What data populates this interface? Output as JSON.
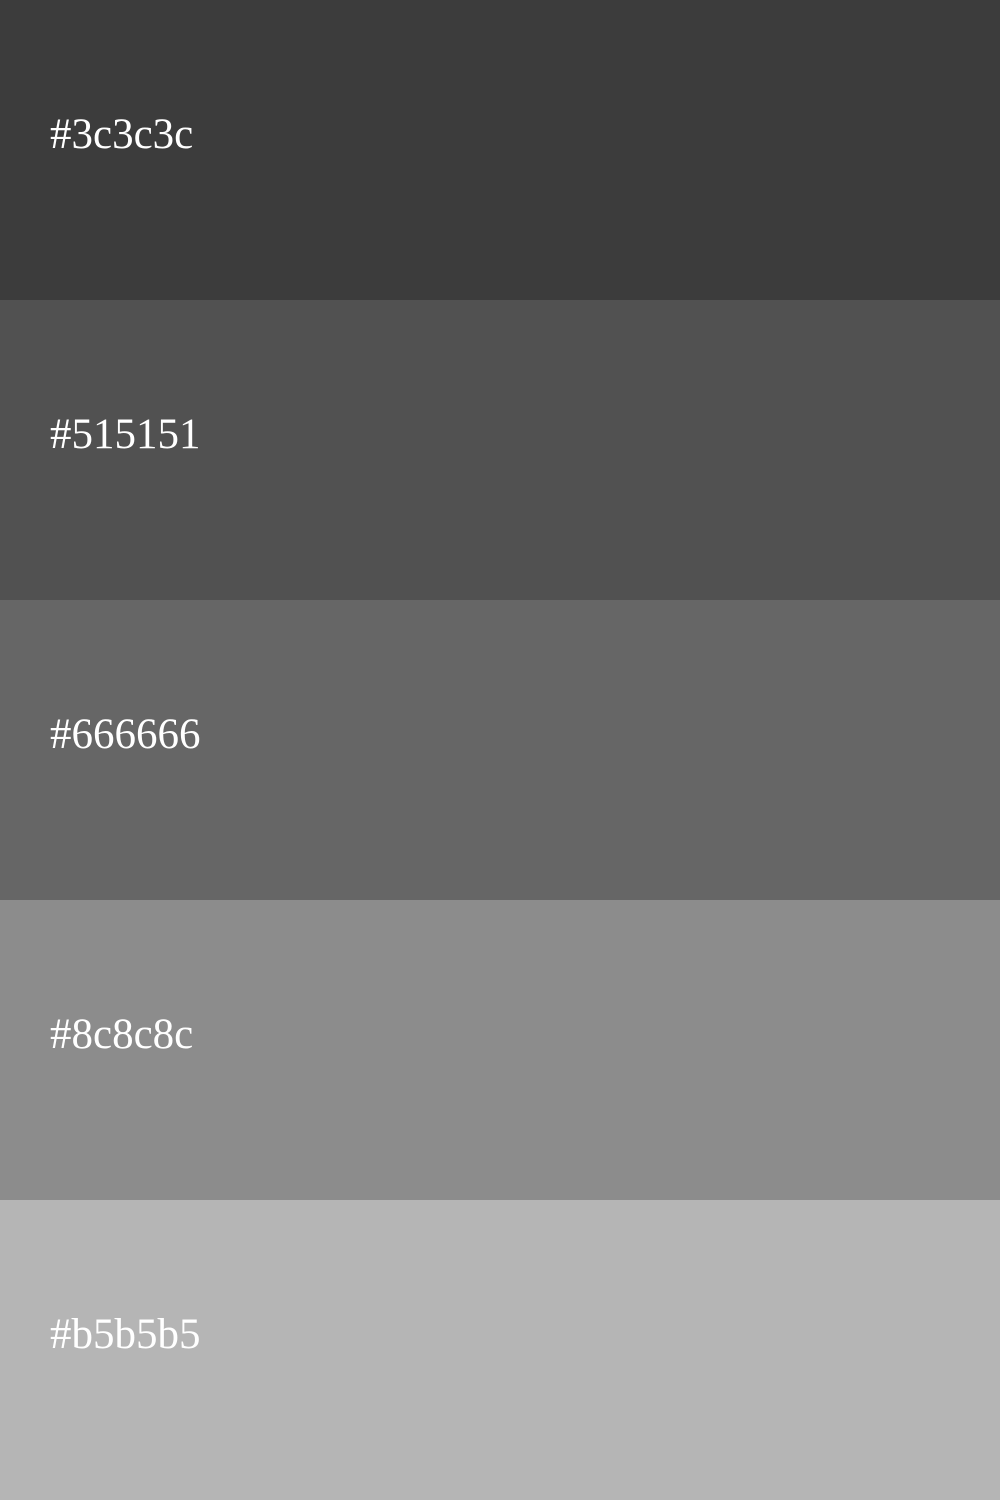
{
  "swatches": [
    {
      "label": "#3c3c3c",
      "color": "#3c3c3c"
    },
    {
      "label": "#515151",
      "color": "#515151"
    },
    {
      "label": "#666666",
      "color": "#666666"
    },
    {
      "label": "#8c8c8c",
      "color": "#8c8c8c"
    },
    {
      "label": "#b5b5b5",
      "color": "#b5b5b5"
    }
  ],
  "label_color": "#ffffff"
}
